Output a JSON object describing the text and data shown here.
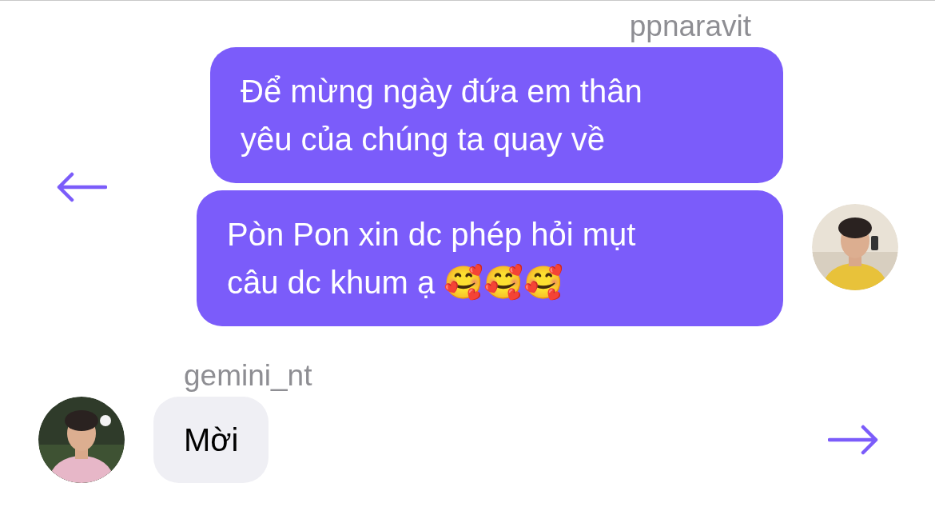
{
  "threads": [
    {
      "sender": "ppnaravit",
      "kind": "outgoing",
      "bubbles": [
        "Để mừng ngày đứa em thân yêu của chúng ta quay về",
        "Pòn Pon xin dc phép hỏi mụt câu dc khum ạ 🥰🥰🥰"
      ],
      "avatar": {
        "kind": "picture"
      }
    },
    {
      "sender": "gemini_nt",
      "kind": "incoming",
      "bubbles": [
        "Mời"
      ],
      "avatar": {
        "kind": "picture"
      }
    }
  ]
}
